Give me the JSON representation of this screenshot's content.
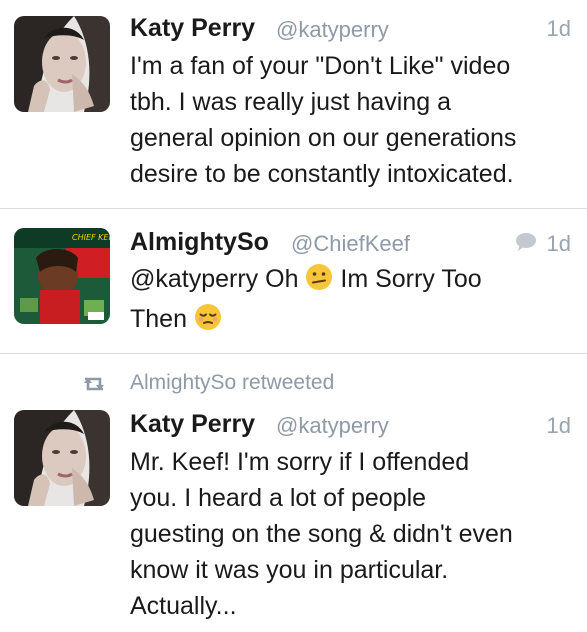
{
  "tweets": [
    {
      "name": "Katy Perry",
      "handle": "@katyperry",
      "time": "1d",
      "lines": [
        "I'm a fan of your \"Don't Like\" video",
        "tbh. I was really just having a",
        "general opinion on our generations",
        "desire to be constantly intoxicated."
      ],
      "avatar_icon": "katy-perry-portrait"
    },
    {
      "name": "AlmightySo",
      "handle": "@ChiefKeef",
      "time": "1d",
      "line1_text": "@katyperry Oh",
      "line1_after": "Im Sorry Too",
      "line2_text": "Then",
      "avatar_icon": "album-cover",
      "album_text": "CHIEF KEEF",
      "reply_icon": "speech-bubble-icon"
    },
    {
      "retweet_label": "AlmightySo retweeted",
      "name": "Katy Perry",
      "handle": "@katyperry",
      "time": "1d",
      "lines": [
        "Mr. Keef! I'm sorry if I offended",
        "you. I heard a lot of people",
        "guesting on the song & didn't even",
        "know it was you in particular.",
        "Actually..."
      ],
      "avatar_icon": "katy-perry-portrait"
    }
  ],
  "colors": {
    "divider": "#d9dde1",
    "handle": "#8e9aa6",
    "text": "#1a1a1a"
  }
}
